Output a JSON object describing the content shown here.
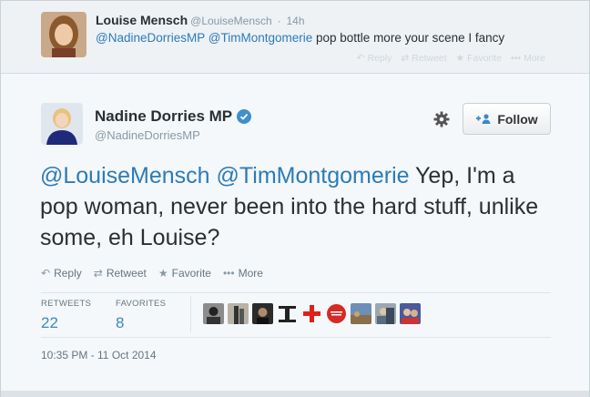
{
  "reply": {
    "name": "Louise Mensch",
    "handle": "@LouiseMensch",
    "separator": "·",
    "time": "14h",
    "mention1": "@NadineDorriesMP",
    "mention2": "@TimMontgomerie",
    "text": "pop bottle more your scene I fancy",
    "actions": {
      "reply": "Reply",
      "retweet": "Retweet",
      "favorite": "Favorite",
      "more": "More"
    }
  },
  "tweet": {
    "name": "Nadine Dorries MP",
    "handle": "@NadineDorriesMP",
    "follow_label": "Follow",
    "mention1": "@LouiseMensch",
    "mention2": "@TimMontgomerie",
    "text": "Yep, I'm a pop woman, never been into the hard stuff, unlike some, eh Louise?",
    "actions": {
      "reply": "Reply",
      "retweet": "Retweet",
      "favorite": "Favorite",
      "more": "More"
    },
    "stats": {
      "retweets_label": "RETWEETS",
      "retweets": "22",
      "favorites_label": "FAVORITES",
      "favorites": "8"
    },
    "timestamp": "10:35 PM - 11 Oct 2014"
  },
  "colors": {
    "link": "#2b7bb9",
    "verified": "#3d8fd0",
    "muted": "#8899a6",
    "stat_number": "#3b88c3"
  },
  "icons": [
    "reply-icon",
    "retweet-icon",
    "star-icon",
    "more-dots-icon",
    "gear-icon",
    "follow-person-icon",
    "verified-badge-icon"
  ]
}
